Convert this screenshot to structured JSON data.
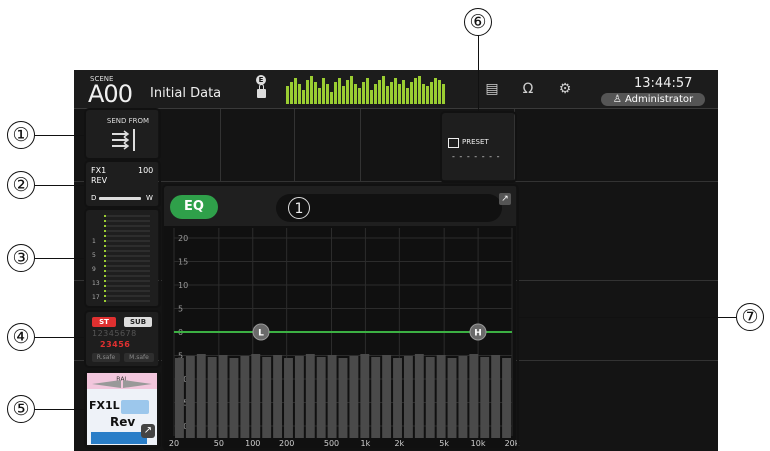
{
  "topbar": {
    "scene_small": "SCENE",
    "scene_num": "A00",
    "scene_name": "Initial Data",
    "e_badge": "E",
    "clock": "13:44:57",
    "user": "Administrator",
    "icons": [
      "meter-icon",
      "headphone-icon",
      "setup-gear-icon"
    ]
  },
  "send_from": {
    "label": "SEND FROM"
  },
  "fx": {
    "name": "FX1",
    "value": "100",
    "type": "REV",
    "dry": "D",
    "wet": "W"
  },
  "meter_ticks": [
    "1",
    "5",
    "9",
    "13",
    "17"
  ],
  "assign": {
    "st": "ST",
    "sub": "SUB",
    "row1": "12345678",
    "row2": "23456",
    "r_safe": "R.safe",
    "m_safe": "M.safe"
  },
  "channel": {
    "bal": "BAL",
    "name": "FX1L",
    "type": "Rev"
  },
  "preset": {
    "label": "PRESET",
    "value": "- - - - - - -"
  },
  "eq": {
    "label": "EQ",
    "channel_num": "1",
    "y_ticks": [
      "20",
      "15",
      "10",
      "5",
      "0",
      "5",
      "10",
      "15",
      "20"
    ],
    "x_ticks": [
      "20",
      "50",
      "100",
      "200",
      "500",
      "1k",
      "2k",
      "5k",
      "10k",
      "20k"
    ],
    "low_handle": "L",
    "high_handle": "H"
  },
  "callouts": [
    "①",
    "②",
    "③",
    "④",
    "⑤",
    "⑥",
    "⑦"
  ],
  "colors": {
    "eq_green": "#2fa04a",
    "st_red": "#e03030",
    "meter_green": "#9acd32",
    "handle_gray": "#6a6a6a"
  }
}
